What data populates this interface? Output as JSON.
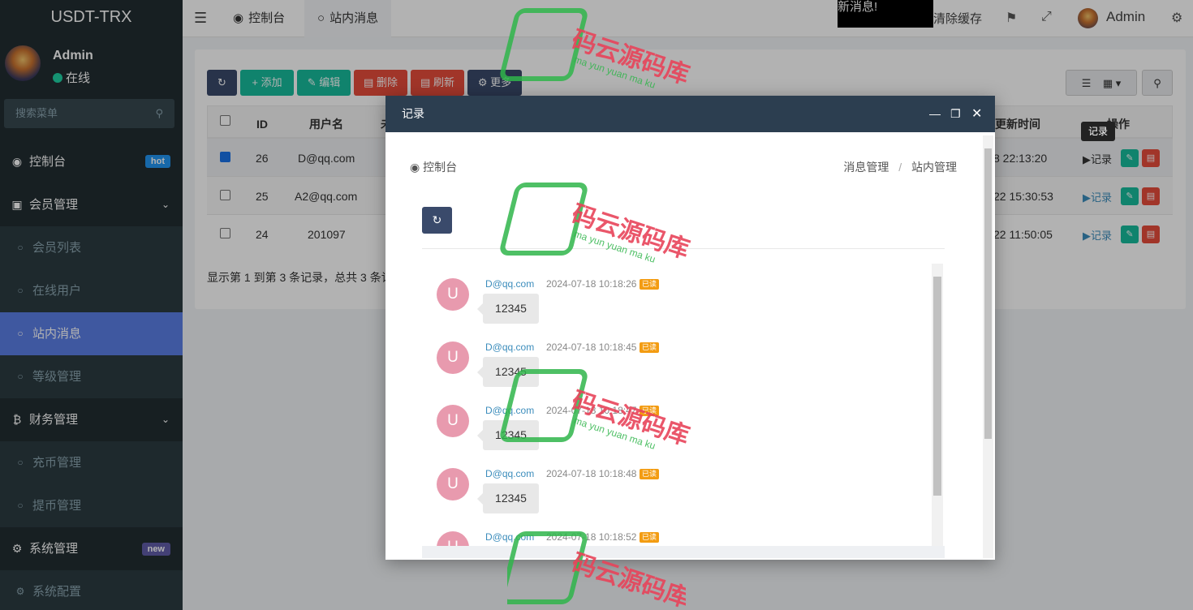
{
  "app": {
    "title": "USDT-TRX"
  },
  "user": {
    "name": "Admin",
    "status": "在线"
  },
  "sidebar": {
    "search_placeholder": "搜索菜单",
    "items": [
      {
        "label": "控制台",
        "badge": "hot",
        "badge_color": "#2196f3"
      },
      {
        "label": "会员管理"
      },
      {
        "label": "会员列表"
      },
      {
        "label": "在线用户"
      },
      {
        "label": "站内消息"
      },
      {
        "label": "等级管理"
      },
      {
        "label": "财务管理"
      },
      {
        "label": "充币管理"
      },
      {
        "label": "提币管理"
      },
      {
        "label": "系统管理",
        "badge": "new",
        "badge_color": "#605ca8"
      },
      {
        "label": "系统配置"
      }
    ]
  },
  "topbar": {
    "tabs": [
      {
        "label": "控制台"
      },
      {
        "label": "站内消息"
      }
    ],
    "notice": "新消息!",
    "clear_cache": "清除缓存",
    "user": "Admin"
  },
  "toolbar": {
    "add": "添加",
    "edit": "编辑",
    "delete": "删除",
    "refresh": "刷新",
    "more": "更多"
  },
  "table": {
    "columns": [
      "ID",
      "用户名",
      "未",
      "更新时间",
      "操作"
    ],
    "rows": [
      {
        "id": "26",
        "user": "D@qq.com",
        "time": "8 22:13:20",
        "checked": true
      },
      {
        "id": "25",
        "user": "A2@qq.com",
        "time": "22 15:30:53",
        "checked": false
      },
      {
        "id": "24",
        "user": "201097",
        "time": "22 11:50:05",
        "checked": false
      }
    ],
    "action_label": "记录",
    "footer": "显示第 1 到第 3 条记录，总共 3 条记"
  },
  "tooltip": "记录",
  "modal": {
    "title": "记录",
    "breadcrumb_left": "控制台",
    "breadcrumb_right": [
      "消息管理",
      "/",
      "站内管理"
    ],
    "messages": [
      {
        "avatar": "U",
        "user": "D@qq.com",
        "time": "2024-07-18 10:18:26",
        "read": "已读",
        "text": "12345"
      },
      {
        "avatar": "U",
        "user": "D@qq.com",
        "time": "2024-07-18 10:18:45",
        "read": "已读",
        "text": "12345"
      },
      {
        "avatar": "U",
        "user": "D@qq.com",
        "time": "2024-07-18 10:18:47",
        "read": "已读",
        "text": "12345"
      },
      {
        "avatar": "U",
        "user": "D@qq.com",
        "time": "2024-07-18 10:18:48",
        "read": "已读",
        "text": "12345"
      },
      {
        "avatar": "U",
        "user": "D@qq.com",
        "time": "2024-07-18 10:18:52",
        "read": "已读",
        "text": ""
      }
    ]
  },
  "watermark": {
    "text": "码云源码库",
    "sub": "ma yun yuan ma ku"
  }
}
